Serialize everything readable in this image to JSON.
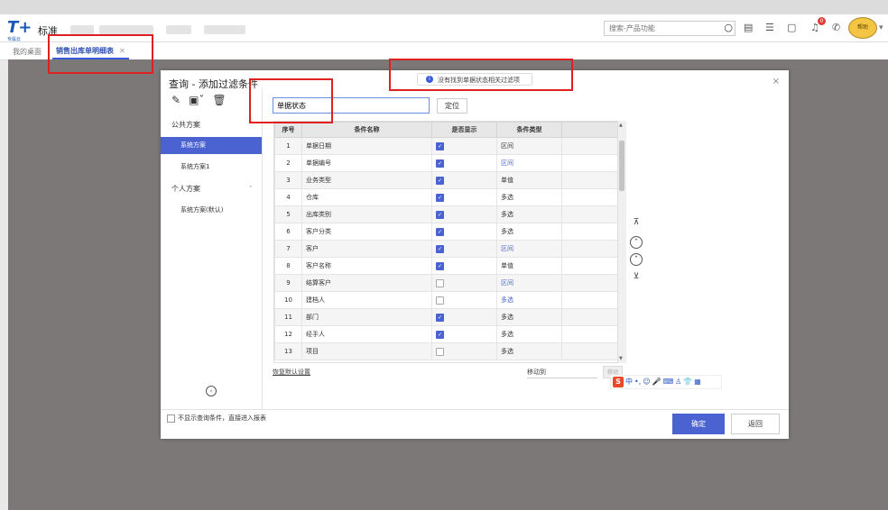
{
  "header": {
    "logo_text": "T+",
    "logo_sub": "专属云",
    "app_title": "标准",
    "search_placeholder": "搜索-产品功能",
    "notification_count": "0",
    "mascot_text": "帮助"
  },
  "tabs": {
    "home": "我的桌面",
    "active": "销售出库单明细表",
    "close": "✕"
  },
  "modal": {
    "title": "查询 - 添加过滤条件",
    "close": "×",
    "toast": "没有找到单据状态相关过滤项",
    "find_value": "单据状态",
    "locate_label": "定位",
    "public_scheme": "公共方案",
    "scheme_items": [
      "系统方案",
      "系统方案1"
    ],
    "personal_scheme": "个人方案",
    "personal_items": [
      "系统方案(默认)"
    ],
    "columns": [
      "序号",
      "条件名称",
      "是否显示",
      "条件类型"
    ],
    "rows": [
      {
        "no": "1",
        "name": "单据日期",
        "show": true,
        "type": "区间",
        "blue": false
      },
      {
        "no": "2",
        "name": "单据编号",
        "show": true,
        "type": "区间",
        "blue": true
      },
      {
        "no": "3",
        "name": "业务类型",
        "show": true,
        "type": "单值",
        "blue": false
      },
      {
        "no": "4",
        "name": "仓库",
        "show": true,
        "type": "多选",
        "blue": false
      },
      {
        "no": "5",
        "name": "出库类别",
        "show": true,
        "type": "多选",
        "blue": false
      },
      {
        "no": "6",
        "name": "客户分类",
        "show": true,
        "type": "多选",
        "blue": false
      },
      {
        "no": "7",
        "name": "客户",
        "show": true,
        "type": "区间",
        "blue": true
      },
      {
        "no": "8",
        "name": "客户名称",
        "show": true,
        "type": "单值",
        "blue": false
      },
      {
        "no": "9",
        "name": "结算客户",
        "show": false,
        "type": "区间",
        "blue": true
      },
      {
        "no": "10",
        "name": "建档人",
        "show": false,
        "type": "多选",
        "blue": true
      },
      {
        "no": "11",
        "name": "部门",
        "show": true,
        "type": "多选",
        "blue": false
      },
      {
        "no": "12",
        "name": "经手人",
        "show": true,
        "type": "多选",
        "blue": false
      },
      {
        "no": "13",
        "name": "项目",
        "show": false,
        "type": "多选",
        "blue": false
      }
    ],
    "restore_default": "恢复默认设置",
    "move_to": "移动到",
    "move_btn": "移动",
    "skip_label": "不显示查询条件，直接进入报表",
    "ok": "确定",
    "back": "返回",
    "ime": {
      "logo": "S",
      "items": [
        "中",
        "•,",
        "☺",
        "🎤",
        "⌨",
        "♙",
        "👕",
        "▦"
      ]
    }
  }
}
